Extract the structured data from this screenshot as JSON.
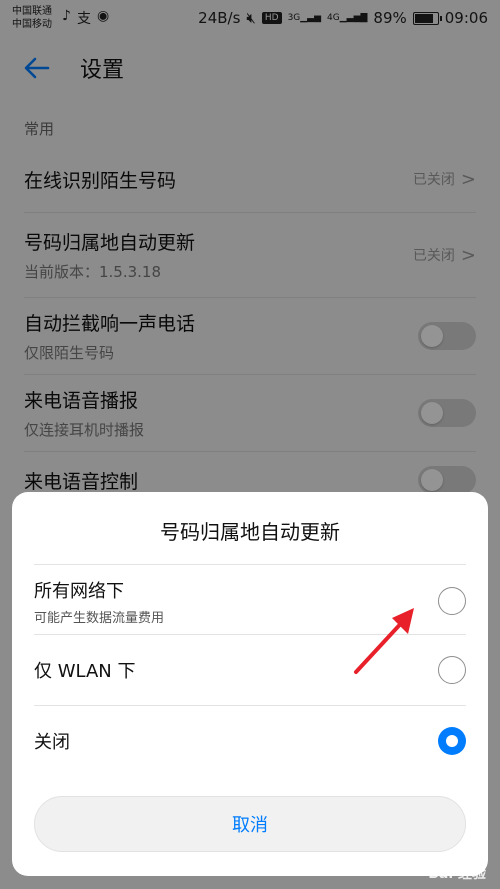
{
  "status_bar": {
    "carrier1": "中国联通",
    "carrier2": "中国移动",
    "app_icons": [
      "♪",
      "支",
      "◉"
    ],
    "net_speed": "24B/s",
    "hd": "HD",
    "sig1": "3G",
    "sig2": "4G",
    "battery": "89%",
    "battery_level": 0.89,
    "time": "09:06"
  },
  "appbar": {
    "title": "设置"
  },
  "section": {
    "label": "常用"
  },
  "rows": [
    {
      "main": "在线识别陌生号码",
      "value": "已关闭"
    },
    {
      "main": "号码归属地自动更新",
      "sub": "当前版本：1.5.3.18",
      "value": "已关闭"
    },
    {
      "main": "自动拦截响一声电话",
      "sub": "仅限陌生号码"
    },
    {
      "main": "来电语音播报",
      "sub": "仅连接耳机时播报"
    },
    {
      "main": "来电语音控制"
    }
  ],
  "dialog": {
    "title": "号码归属地自动更新",
    "options": [
      {
        "main": "所有网络下",
        "sub": "可能产生数据流量费用",
        "selected": false
      },
      {
        "main": "仅 WLAN 下",
        "selected": false
      },
      {
        "main": "关闭",
        "selected": true
      }
    ],
    "cancel": "取消"
  },
  "colors": {
    "accent": "#007dff",
    "arrow": "#e8202a"
  },
  "watermark": "Bai 经验"
}
